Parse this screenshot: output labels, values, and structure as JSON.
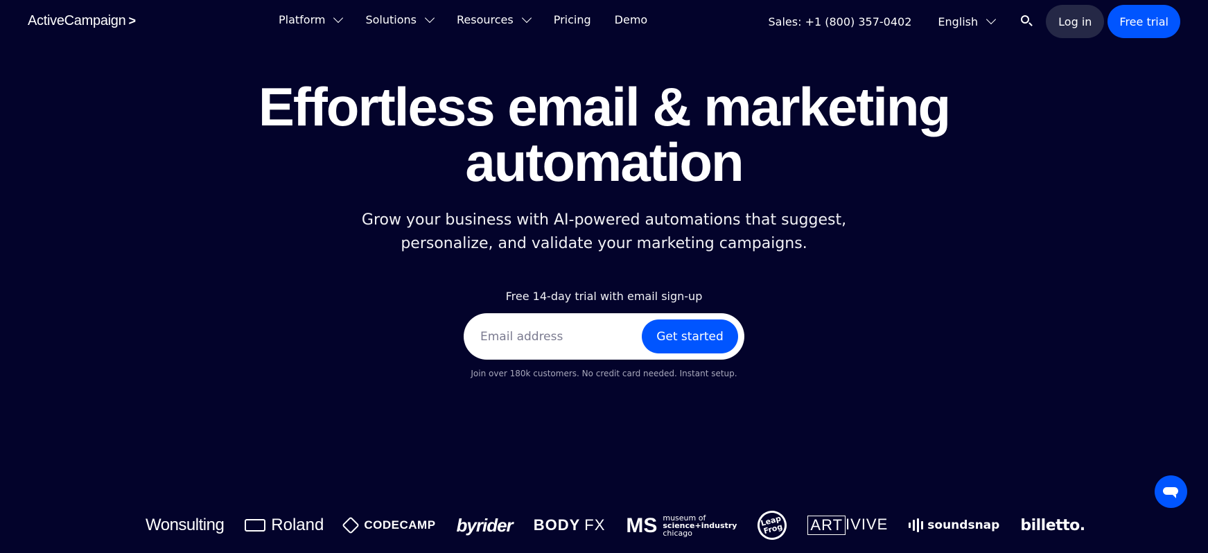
{
  "nav": {
    "logo": "ActiveCampaign",
    "logo_chevron": ">",
    "links": [
      {
        "label": "Platform",
        "has_dropdown": true
      },
      {
        "label": "Solutions",
        "has_dropdown": true
      },
      {
        "label": "Resources",
        "has_dropdown": true
      },
      {
        "label": "Pricing",
        "has_dropdown": false
      },
      {
        "label": "Demo",
        "has_dropdown": false
      }
    ],
    "sales": "Sales: +1 (800) 357-0402",
    "language": "English",
    "search_icon": "search-icon",
    "login_label": "Log in",
    "trial_label": "Free trial"
  },
  "hero": {
    "title_line1": "Effortless email & marketing",
    "title_line2": "automation",
    "subtitle_line1": "Grow your business with AI-powered automations that suggest,",
    "subtitle_line2": "personalize, and validate your marketing campaigns.",
    "trial_label": "Free 14-day trial with email sign-up",
    "email_placeholder": "Email address",
    "email_value": "",
    "cta_label": "Get started",
    "fine_print": "Join over 180k customers. No credit card needed. Instant setup."
  },
  "logos": {
    "wonsulting": "Wonsulting",
    "roland": "Roland",
    "codecamp": "CODECAMP",
    "byrider": "byrider",
    "bodyfx_body": "BODY",
    "bodyfx_fx": "FX",
    "msi_mark": "MS",
    "msi_line1": "museum of",
    "msi_line2": "science+industry",
    "msi_line3": "chicago",
    "leapfrog_line1": "Leap",
    "leapfrog_line2": "Frog",
    "artivive_boxed": "ART",
    "artivive_rest": "IVIVE",
    "soundsnap": "soundsnap",
    "billetto": "billetto."
  },
  "chat": {
    "icon": "chat-icon"
  },
  "colors": {
    "background": "#03032b",
    "accent": "#0055ff",
    "login_bg": "#252846"
  }
}
